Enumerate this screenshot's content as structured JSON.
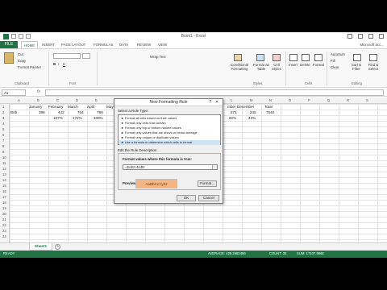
{
  "window": {
    "title": "Book1 - Excel",
    "signin": "Microsoft acc..."
  },
  "ribbon_tabs": {
    "file": "FILE",
    "items": [
      "HOME",
      "INSERT",
      "PAGE LAYOUT",
      "FORMULAS",
      "DATA",
      "REVIEW",
      "VIEW"
    ]
  },
  "ribbon": {
    "cut": "Cut",
    "copy": "Copy",
    "format_painter": "Format Painter",
    "clipboard_group": "Clipboard",
    "font_group": "Font",
    "wrap_text": "Wrap Text",
    "conditional_formatting": "Conditional Formatting",
    "format_as_table": "Format as Table",
    "cell_styles": "Cell Styles",
    "insert": "Insert",
    "delete": "Delete",
    "format": "Format",
    "styles_group": "Styles",
    "cells_group": "Cells",
    "autosum": "AutoSum",
    "fill": "Fill",
    "clear": "Clear",
    "sort_filter": "Sort & Filter",
    "find_select": "Find & Select",
    "editing_group": "Editing"
  },
  "formula_bar": {
    "name_box": "A1",
    "fx": "fx",
    "value": ""
  },
  "grid": {
    "columns": [
      "A",
      "B",
      "C",
      "D",
      "E",
      "F",
      "G",
      "H",
      "I",
      "J",
      "K",
      "L",
      "M",
      "N",
      "O",
      "P",
      "Q",
      "R",
      "S",
      "T"
    ],
    "rows": [
      "1",
      "2",
      "3",
      "4",
      "5",
      "6",
      "7",
      "8",
      "9",
      "10",
      "11",
      "12",
      "13",
      "14",
      "15",
      "16",
      "17",
      "18",
      "19",
      "20",
      "21",
      "22",
      "23",
      "24"
    ],
    "header_row": {
      "b1": "January",
      "c1": "February",
      "d1": "March",
      "e1": "April",
      "f1": "May",
      "l1": "mber",
      "m1": "December",
      "n1": "Total"
    },
    "row2": {
      "a2": "Bob",
      "b2": "396",
      "c2": "442",
      "d2": "764",
      "e2": "780",
      "l2": "571",
      "m2": "245",
      "n2": "7540"
    },
    "row3": {
      "c3": "107%",
      "d3": "172%",
      "e3": "100%",
      "l3": "60%",
      "m3": "43%"
    }
  },
  "sheet_tabs": {
    "active": "Sheet1",
    "add": "+"
  },
  "status": {
    "ready": "READY",
    "average": "AVERAGE: 429.2982456",
    "count": "COUNT: 35",
    "sum": "SUM: 17107.9666"
  },
  "dialog": {
    "title": "New Formatting Rule",
    "help": "?",
    "close": "✕",
    "select_rule_type": "Select a Rule Type:",
    "rule_types": [
      "► Format all cells based on their values",
      "► Format only cells that contain",
      "► Format only top or bottom ranked values",
      "► Format only values that are above or below average",
      "► Format only unique or duplicate values",
      "► Use a formula to determine which cells to format"
    ],
    "selected_rule_index": 5,
    "edit_description": "Edit the Rule Description:",
    "formula_label": "Format values where this formula is true:",
    "formula_value": "=$A$2>$A$3",
    "preview_label": "Preview:",
    "preview_sample": "AaBbCcYyZz",
    "format_button": "Format...",
    "ok_button": "OK",
    "cancel_button": "Cancel"
  },
  "colors": {
    "excel_green": "#217346",
    "preview_fill": "#f4b483",
    "selection": "#cfe3f5"
  }
}
